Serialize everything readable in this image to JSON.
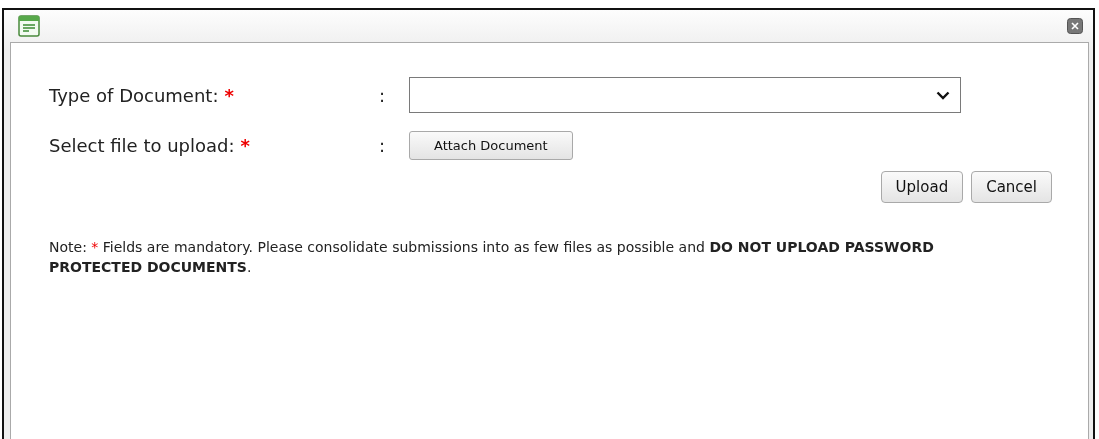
{
  "required_symbol": "*",
  "fields": [
    {
      "label": "Type of Document:",
      "required": true,
      "separator": ":",
      "kind": "select"
    },
    {
      "label": "Select file to upload:",
      "required": true,
      "separator": ":",
      "kind": "file",
      "button": "Attach Document"
    }
  ],
  "actions": [
    "Upload",
    "Cancel"
  ],
  "note": [
    {
      "kind": "plain",
      "text": "Note: "
    },
    {
      "kind": "required",
      "text": "*"
    },
    {
      "kind": "plain",
      "text": " Fields are mandatory. Please consolidate submissions into as few files as possible and "
    },
    {
      "kind": "bold",
      "text": "DO NOT UPLOAD PASSWORD PROTECTED DOCUMENTS"
    },
    {
      "kind": "plain",
      "text": "."
    }
  ]
}
